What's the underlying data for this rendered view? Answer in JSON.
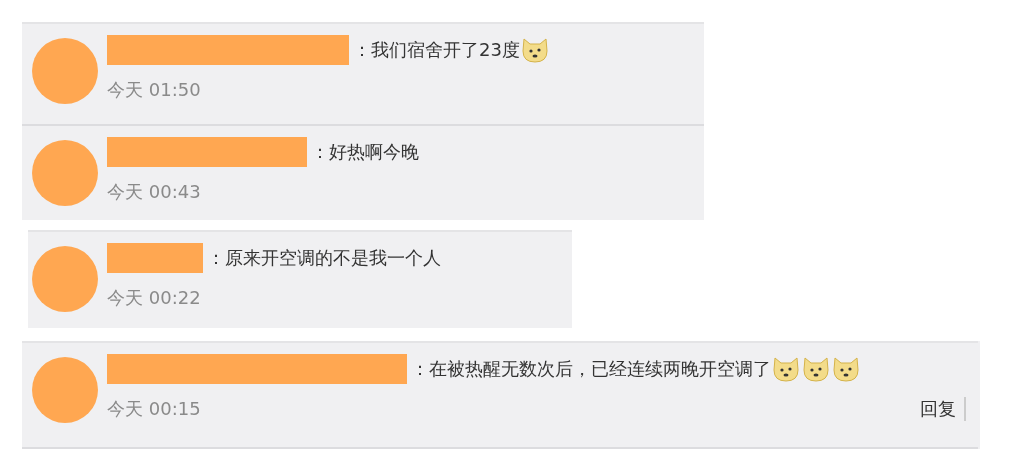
{
  "groups": [
    {
      "comments": [
        {
          "text": "：我们宿舍开了23度",
          "emojis": [
            {
              "kind": "doge"
            }
          ],
          "time": "今天 01:50"
        },
        {
          "text": "：好热啊今晚",
          "time": "今天 00:43"
        }
      ]
    },
    {
      "comments": [
        {
          "text": "：原来开空调的不是我一个人",
          "time": "今天 00:22"
        }
      ]
    },
    {
      "comments": [
        {
          "text": "：在被热醒无数次后，已经连续两晚开空调了",
          "emojis": [
            {
              "kind": "doge"
            },
            {
              "kind": "doge"
            },
            {
              "kind": "doge"
            }
          ],
          "time": "今天 00:15",
          "reply": "回复"
        }
      ]
    }
  ]
}
